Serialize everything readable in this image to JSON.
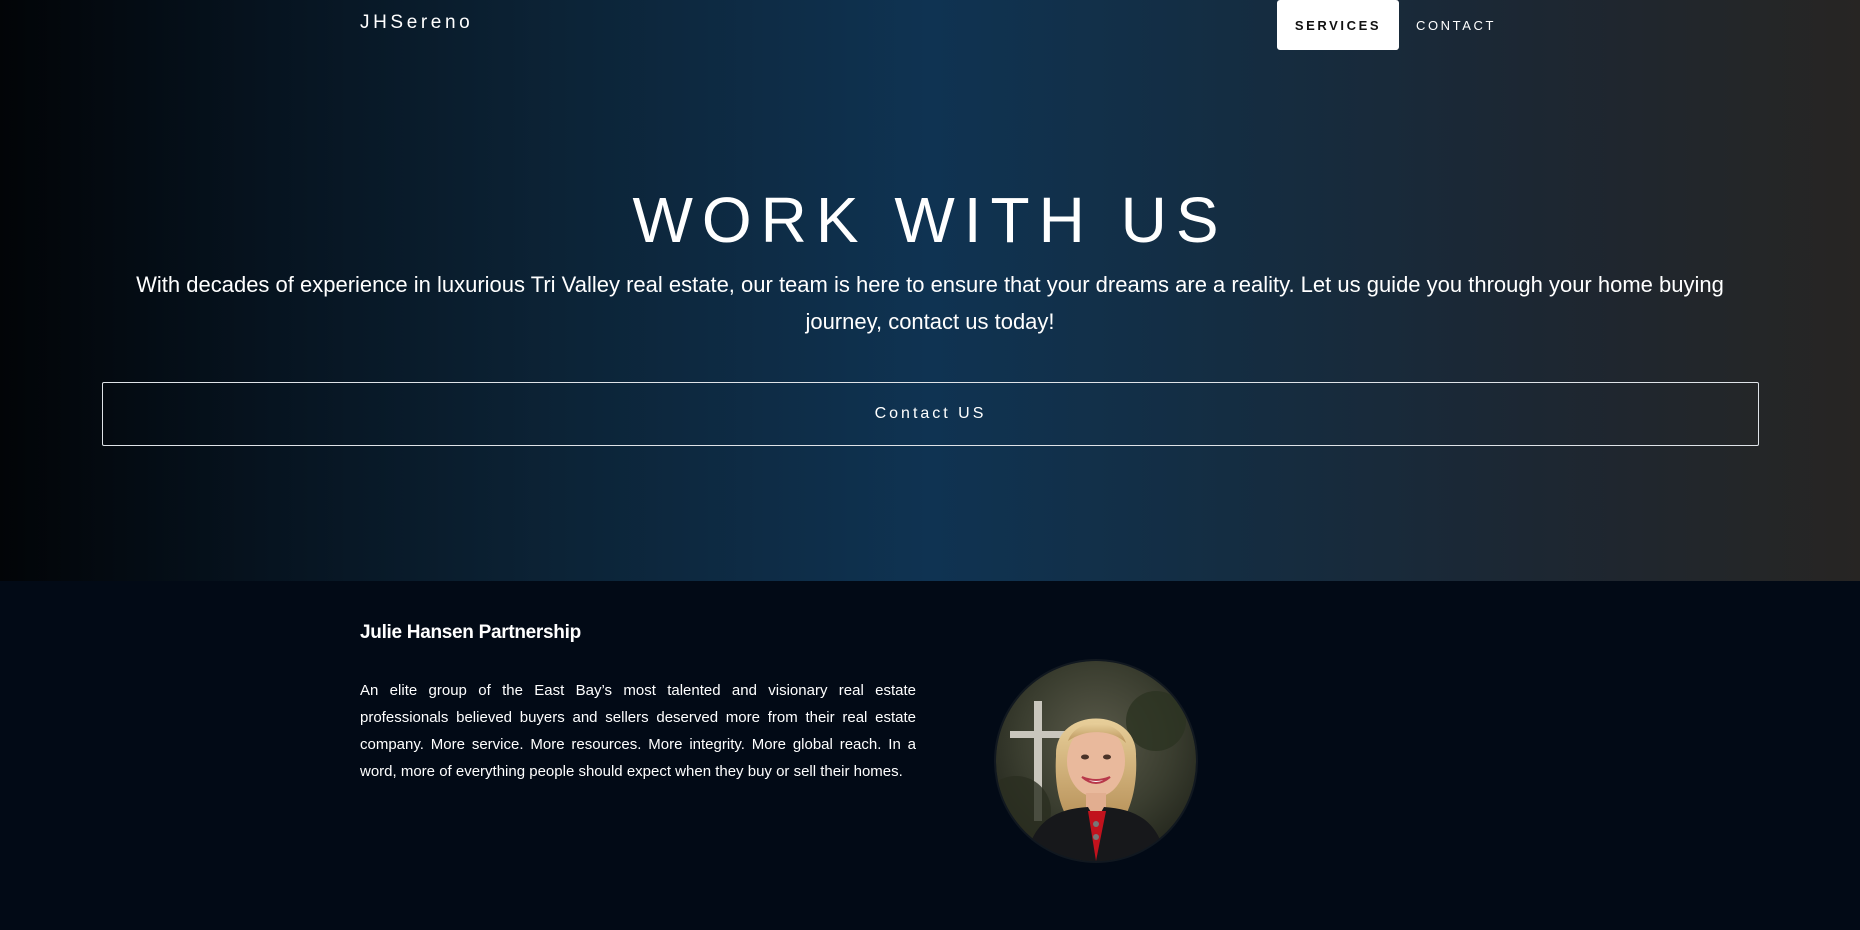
{
  "header": {
    "brand": "JHSereno",
    "nav": {
      "services_label": "SERVICES",
      "contact_label": "CONTACT"
    }
  },
  "hero": {
    "title": "WORK WITH US",
    "subtitle": "With decades of experience in luxurious Tri Valley real estate, our team is here to ensure that your dreams are a reality. Let us guide you through your home buying journey, contact us today!",
    "cta_label": "Contact US"
  },
  "about": {
    "title": "Julie Hansen Partnership",
    "text": "An elite group of the East Bay’s most talented and visionary real estate professionals believed buyers and sellers deserved more from their real estate company. More service. More resources. More integrity. More global reach. In a word, more of everything people should expect when they buy or sell their homes."
  },
  "colors": {
    "hero_gradient_center": "#0f3352",
    "section_background": "#020a16",
    "button_active_bg": "#ffffff",
    "cta_border": "#dfe3e8"
  }
}
